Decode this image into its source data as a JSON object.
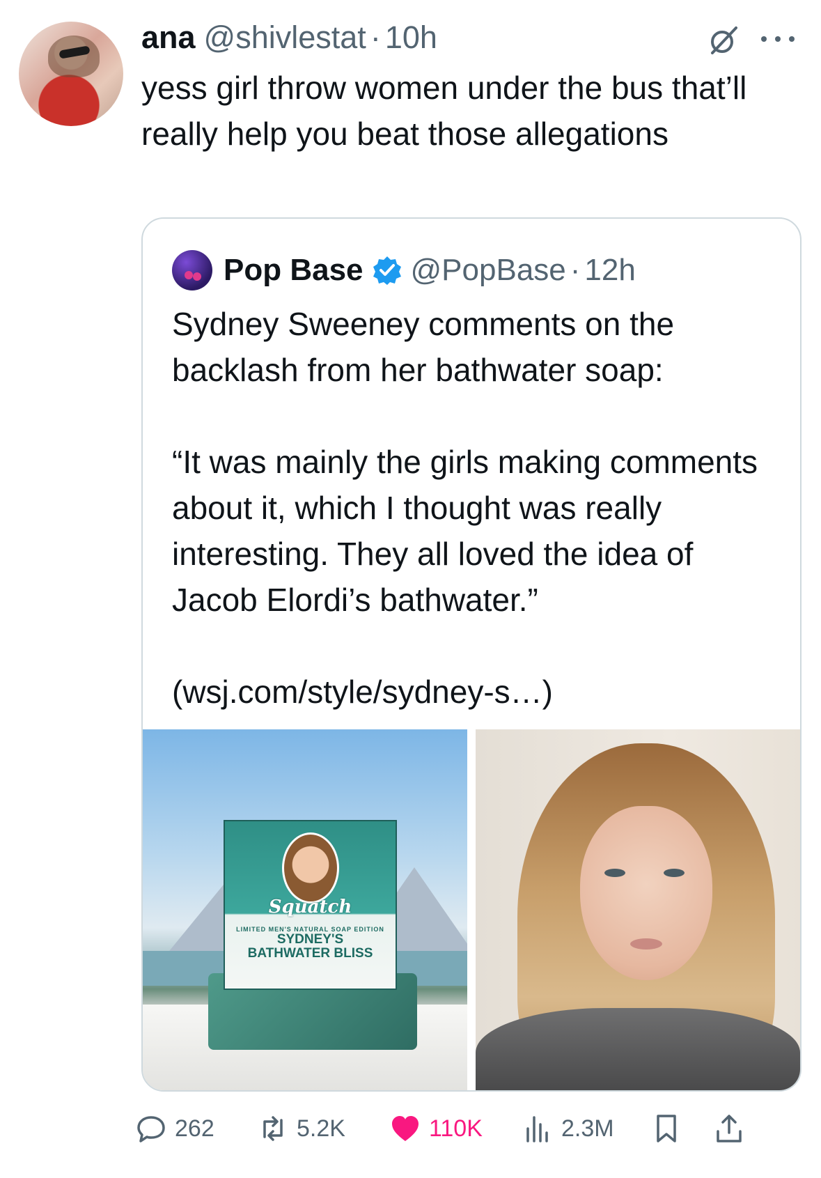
{
  "tweet": {
    "author_name": "ana",
    "author_handle": "@shivlestat",
    "separator": "·",
    "time": "10h",
    "text": "yess girl throw women under the bus that’ll really help you beat those allegations"
  },
  "quote": {
    "author_name": "Pop Base",
    "author_handle": "@PopBase",
    "separator": "·",
    "time": "12h",
    "text": "Sydney Sweeney comments on the backlash from her bathwater soap:\n\n“It was mainly the girls making comments about it, which I thought was really interesting. They all loved the idea of Jacob Elordi’s bathwater.”\n\n(wsj.com/style/sydney-s…)",
    "soap_box": {
      "brand": "Squatch",
      "edition": "LIMITED   MEN'S NATURAL SOAP   EDITION",
      "name_line1": "SYDNEY'S",
      "name_line2": "BATHWATER BLISS"
    }
  },
  "actions": {
    "replies": "262",
    "reposts": "5.2K",
    "likes": "110K",
    "views": "2.3M"
  },
  "colors": {
    "text": "#0f1419",
    "muted": "#536471",
    "like": "#f91880",
    "verified": "#1d9bf0",
    "border": "#cfd9de"
  },
  "icons": [
    "grok-icon",
    "more-icon",
    "verified-badge-icon",
    "reply-icon",
    "repost-icon",
    "like-icon",
    "views-icon",
    "bookmark-icon",
    "share-icon"
  ]
}
